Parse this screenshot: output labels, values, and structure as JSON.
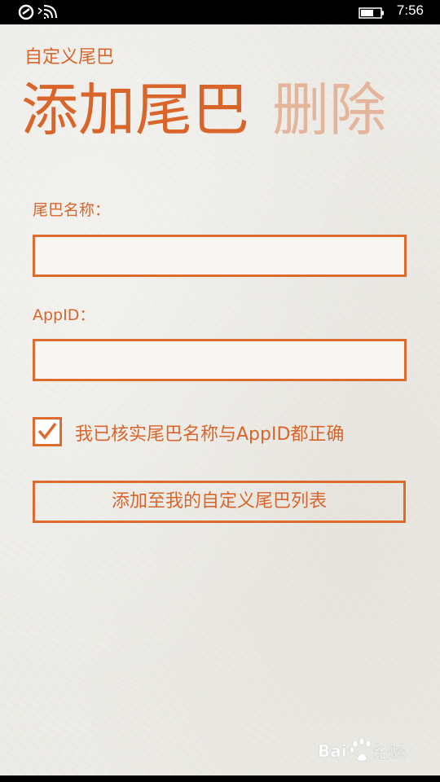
{
  "status_bar": {
    "time": "7:56",
    "icons": [
      "app-notification-icon",
      "signal-icon",
      "wifi-icon",
      "battery-icon"
    ]
  },
  "app": {
    "title": "自定义尾巴"
  },
  "pivot": {
    "tabs": [
      {
        "label": "添加尾巴",
        "active": true
      },
      {
        "label": "删除",
        "active": false
      }
    ]
  },
  "form": {
    "name_label": "尾巴名称：",
    "name_value": "",
    "appid_label": "AppID：",
    "appid_value": "",
    "confirm_label": "我已核实尾巴名称与AppID都正确",
    "confirm_checked": true,
    "submit_label": "添加至我的自定义尾巴列表"
  },
  "watermark": {
    "text": "Bai 经验"
  },
  "colors": {
    "accent": "#dd6a2e",
    "accent_faded": "#e4b49b",
    "background": "#ecebe6"
  }
}
